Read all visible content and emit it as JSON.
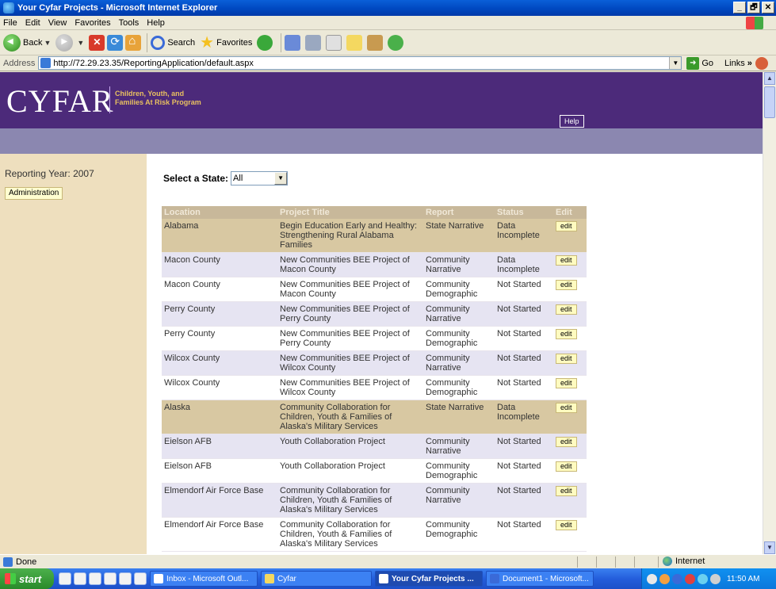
{
  "window": {
    "title": "Your Cyfar Projects - Microsoft Internet Explorer",
    "controls": [
      "_",
      "🗗",
      "✕"
    ]
  },
  "menu": [
    "File",
    "Edit",
    "View",
    "Favorites",
    "Tools",
    "Help"
  ],
  "toolbar": {
    "back_label": "Back",
    "search_label": "Search",
    "favorites_label": "Favorites"
  },
  "address": {
    "label": "Address",
    "url": "http://72.29.23.35/ReportingApplication/default.aspx",
    "go_label": "Go",
    "links_label": "Links"
  },
  "site": {
    "logo": "CYFAR",
    "tagline_1": "Children, Youth, and",
    "tagline_2": "Families At Risk Program",
    "help_label": "Help"
  },
  "sidebar": {
    "reporting_year": "Reporting Year:  2007",
    "admin_label": "Administration"
  },
  "filter": {
    "label": "Select a State:",
    "selected": "All"
  },
  "table": {
    "headers": [
      "Location",
      "Project Title",
      "Report",
      "Status",
      "Edit"
    ],
    "edit_label": "edit",
    "rows": [
      {
        "type": "state",
        "location": "Alabama",
        "title": "Begin Education Early and Healthy: Strengthening Rural Alabama Families",
        "report": "State Narrative",
        "status": "Data Incomplete"
      },
      {
        "type": "odd",
        "location": "Macon County",
        "title": "New Communities BEE Project of Macon County",
        "report": "Community Narrative",
        "status": "Data Incomplete"
      },
      {
        "type": "even",
        "location": "Macon County",
        "title": "New Communities BEE Project of Macon County",
        "report": "Community Demographic",
        "status": "Not Started"
      },
      {
        "type": "odd",
        "location": "Perry County",
        "title": "New Communities BEE Project of Perry County",
        "report": "Community Narrative",
        "status": "Not Started"
      },
      {
        "type": "even",
        "location": "Perry County",
        "title": "New Communities BEE Project of Perry County",
        "report": "Community Demographic",
        "status": "Not Started"
      },
      {
        "type": "odd",
        "location": "Wilcox County",
        "title": "New Communities BEE Project of Wilcox County",
        "report": "Community Narrative",
        "status": "Not Started"
      },
      {
        "type": "even",
        "location": "Wilcox County",
        "title": "New Communities BEE Project of Wilcox County",
        "report": "Community Demographic",
        "status": "Not Started"
      },
      {
        "type": "state",
        "location": "Alaska",
        "title": "Community Collaboration for Children, Youth & Families of Alaska's Military Services",
        "report": "State Narrative",
        "status": "Data Incomplete"
      },
      {
        "type": "odd",
        "location": "Eielson AFB",
        "title": "Youth Collaboration Project",
        "report": "Community Narrative",
        "status": "Not Started"
      },
      {
        "type": "even",
        "location": "Eielson AFB",
        "title": "Youth Collaboration Project",
        "report": "Community Demographic",
        "status": "Not Started"
      },
      {
        "type": "odd",
        "location": "Elmendorf Air Force Base",
        "title": "Community Collaboration for Children, Youth & Families of Alaska's Military Services",
        "report": "Community Narrative",
        "status": "Not Started"
      },
      {
        "type": "even",
        "location": "Elmendorf Air Force Base",
        "title": "Community Collaboration for Children, Youth & Families of Alaska's Military Services",
        "report": "Community Demographic",
        "status": "Not Started"
      }
    ]
  },
  "status_bar": {
    "text": "Done",
    "zone": "Internet"
  },
  "taskbar": {
    "start_label": "start",
    "tasks": [
      {
        "label": "Inbox - Microsoft Outl...",
        "active": false
      },
      {
        "label": "Cyfar",
        "active": false
      },
      {
        "label": "Your Cyfar Projects ...",
        "active": true
      },
      {
        "label": "Document1 - Microsoft...",
        "active": false
      }
    ],
    "clock": "11:50 AM"
  }
}
